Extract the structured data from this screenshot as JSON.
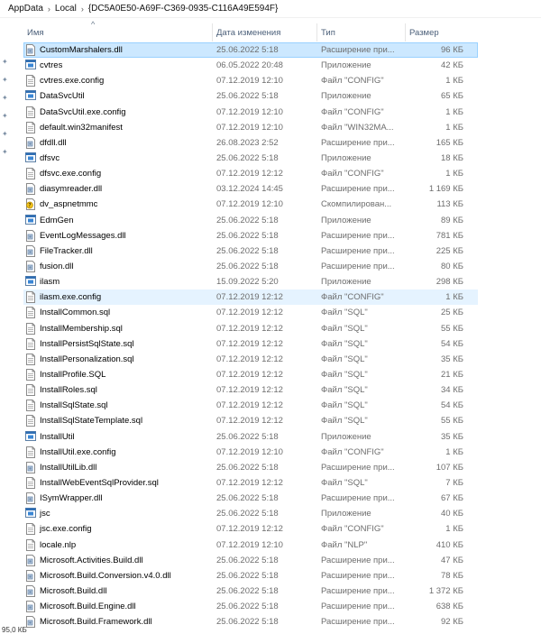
{
  "breadcrumb": [
    "AppData",
    "Local",
    "{DC5A0E50-A69F-C369-0935-C116A49E594F}"
  ],
  "columns": {
    "name": "Имя",
    "date": "Дата изменения",
    "type": "Тип",
    "size": "Размер"
  },
  "files": [
    {
      "name": "CustomMarshalers.dll",
      "date": "25.06.2022 5:18",
      "type": "Расширение при...",
      "size": "96 КБ",
      "icon": "dll-file-icon",
      "state": "selected"
    },
    {
      "name": "cvtres",
      "date": "06.05.2022 20:48",
      "type": "Приложение",
      "size": "42 КБ",
      "icon": "exe-app-icon"
    },
    {
      "name": "cvtres.exe.config",
      "date": "07.12.2019 12:10",
      "type": "Файл \"CONFIG\"",
      "size": "1 КБ",
      "icon": "document-file-icon"
    },
    {
      "name": "DataSvcUtil",
      "date": "25.06.2022 5:18",
      "type": "Приложение",
      "size": "65 КБ",
      "icon": "exe-app-icon"
    },
    {
      "name": "DataSvcUtil.exe.config",
      "date": "07.12.2019 12:10",
      "type": "Файл \"CONFIG\"",
      "size": "1 КБ",
      "icon": "document-file-icon"
    },
    {
      "name": "default.win32manifest",
      "date": "07.12.2019 12:10",
      "type": "Файл \"WIN32MA...",
      "size": "1 КБ",
      "icon": "document-file-icon"
    },
    {
      "name": "dfdll.dll",
      "date": "26.08.2023 2:52",
      "type": "Расширение при...",
      "size": "165 КБ",
      "icon": "dll-file-icon"
    },
    {
      "name": "dfsvc",
      "date": "25.06.2022 5:18",
      "type": "Приложение",
      "size": "18 КБ",
      "icon": "exe-app-icon"
    },
    {
      "name": "dfsvc.exe.config",
      "date": "07.12.2019 12:12",
      "type": "Файл \"CONFIG\"",
      "size": "1 КБ",
      "icon": "document-file-icon"
    },
    {
      "name": "diasymreader.dll",
      "date": "03.12.2024 14:45",
      "type": "Расширение при...",
      "size": "1 169 КБ",
      "icon": "dll-file-icon"
    },
    {
      "name": "dv_aspnetmmc",
      "date": "07.12.2019 12:10",
      "type": "Скомпилирован...",
      "size": "113 КБ",
      "icon": "help-file-icon"
    },
    {
      "name": "EdmGen",
      "date": "25.06.2022 5:18",
      "type": "Приложение",
      "size": "89 КБ",
      "icon": "exe-app-icon"
    },
    {
      "name": "EventLogMessages.dll",
      "date": "25.06.2022 5:18",
      "type": "Расширение при...",
      "size": "781 КБ",
      "icon": "dll-file-icon"
    },
    {
      "name": "FileTracker.dll",
      "date": "25.06.2022 5:18",
      "type": "Расширение при...",
      "size": "225 КБ",
      "icon": "dll-file-icon"
    },
    {
      "name": "fusion.dll",
      "date": "25.06.2022 5:18",
      "type": "Расширение при...",
      "size": "80 КБ",
      "icon": "dll-file-icon"
    },
    {
      "name": "ilasm",
      "date": "15.09.2022 5:20",
      "type": "Приложение",
      "size": "298 КБ",
      "icon": "exe-app-icon"
    },
    {
      "name": "ilasm.exe.config",
      "date": "07.12.2019 12:12",
      "type": "Файл \"CONFIG\"",
      "size": "1 КБ",
      "icon": "document-file-icon",
      "state": "hovered"
    },
    {
      "name": "InstallCommon.sql",
      "date": "07.12.2019 12:12",
      "type": "Файл \"SQL\"",
      "size": "25 КБ",
      "icon": "document-file-icon"
    },
    {
      "name": "InstallMembership.sql",
      "date": "07.12.2019 12:12",
      "type": "Файл \"SQL\"",
      "size": "55 КБ",
      "icon": "document-file-icon"
    },
    {
      "name": "InstallPersistSqlState.sql",
      "date": "07.12.2019 12:12",
      "type": "Файл \"SQL\"",
      "size": "54 КБ",
      "icon": "document-file-icon"
    },
    {
      "name": "InstallPersonalization.sql",
      "date": "07.12.2019 12:12",
      "type": "Файл \"SQL\"",
      "size": "35 КБ",
      "icon": "document-file-icon"
    },
    {
      "name": "InstallProfile.SQL",
      "date": "07.12.2019 12:12",
      "type": "Файл \"SQL\"",
      "size": "21 КБ",
      "icon": "document-file-icon"
    },
    {
      "name": "InstallRoles.sql",
      "date": "07.12.2019 12:12",
      "type": "Файл \"SQL\"",
      "size": "34 КБ",
      "icon": "document-file-icon"
    },
    {
      "name": "InstallSqlState.sql",
      "date": "07.12.2019 12:12",
      "type": "Файл \"SQL\"",
      "size": "54 КБ",
      "icon": "document-file-icon"
    },
    {
      "name": "InstallSqlStateTemplate.sql",
      "date": "07.12.2019 12:12",
      "type": "Файл \"SQL\"",
      "size": "55 КБ",
      "icon": "document-file-icon"
    },
    {
      "name": "InstallUtil",
      "date": "25.06.2022 5:18",
      "type": "Приложение",
      "size": "35 КБ",
      "icon": "exe-app-icon"
    },
    {
      "name": "InstallUtil.exe.config",
      "date": "07.12.2019 12:10",
      "type": "Файл \"CONFIG\"",
      "size": "1 КБ",
      "icon": "document-file-icon"
    },
    {
      "name": "InstallUtilLib.dll",
      "date": "25.06.2022 5:18",
      "type": "Расширение при...",
      "size": "107 КБ",
      "icon": "dll-file-icon"
    },
    {
      "name": "InstallWebEventSqlProvider.sql",
      "date": "07.12.2019 12:12",
      "type": "Файл \"SQL\"",
      "size": "7 КБ",
      "icon": "document-file-icon"
    },
    {
      "name": "ISymWrapper.dll",
      "date": "25.06.2022 5:18",
      "type": "Расширение при...",
      "size": "67 КБ",
      "icon": "dll-file-icon"
    },
    {
      "name": "jsc",
      "date": "25.06.2022 5:18",
      "type": "Приложение",
      "size": "40 КБ",
      "icon": "exe-app-icon"
    },
    {
      "name": "jsc.exe.config",
      "date": "07.12.2019 12:12",
      "type": "Файл \"CONFIG\"",
      "size": "1 КБ",
      "icon": "document-file-icon"
    },
    {
      "name": "locale.nlp",
      "date": "07.12.2019 12:10",
      "type": "Файл \"NLP\"",
      "size": "410 КБ",
      "icon": "document-file-icon"
    },
    {
      "name": "Microsoft.Activities.Build.dll",
      "date": "25.06.2022 5:18",
      "type": "Расширение при...",
      "size": "47 КБ",
      "icon": "dll-file-icon"
    },
    {
      "name": "Microsoft.Build.Conversion.v4.0.dll",
      "date": "25.06.2022 5:18",
      "type": "Расширение при...",
      "size": "78 КБ",
      "icon": "dll-file-icon"
    },
    {
      "name": "Microsoft.Build.dll",
      "date": "25.06.2022 5:18",
      "type": "Расширение при...",
      "size": "1 372 КБ",
      "icon": "dll-file-icon"
    },
    {
      "name": "Microsoft.Build.Engine.dll",
      "date": "25.06.2022 5:18",
      "type": "Расширение при...",
      "size": "638 КБ",
      "icon": "dll-file-icon"
    },
    {
      "name": "Microsoft.Build.Framework.dll",
      "date": "25.06.2022 5:18",
      "type": "Расширение при...",
      "size": "92 КБ",
      "icon": "dll-file-icon"
    }
  ],
  "status": {
    "text": "95,0 КБ"
  },
  "colors": {
    "selected_bg": "#cce8ff",
    "hover_bg": "#e5f3ff",
    "meta_text": "#6d6d6d",
    "header_text": "#4c607a"
  }
}
